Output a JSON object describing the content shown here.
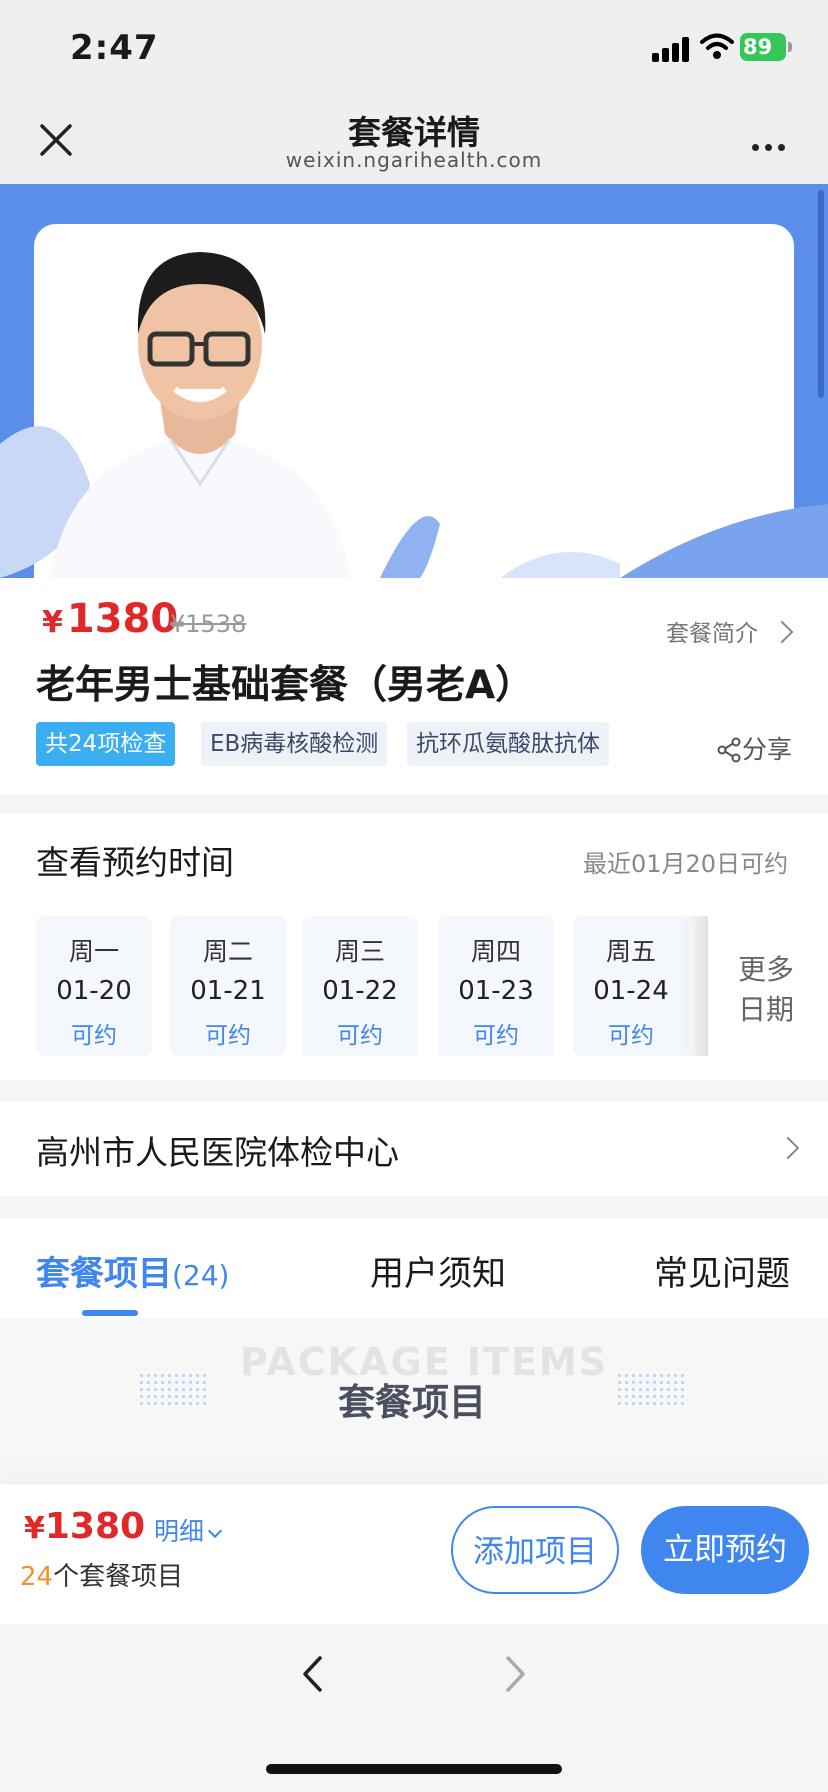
{
  "status": {
    "time": "2:47",
    "battery": "89"
  },
  "nav": {
    "title": "套餐详情",
    "subtitle": "weixin.ngarihealth.com"
  },
  "package": {
    "price_symbol": "¥",
    "price": "1380",
    "old_price": "¥1538",
    "intro_link": "套餐简介",
    "name": "老年男士基础套餐（男老A）",
    "tags": [
      "共24项检查",
      "EB病毒核酸检测",
      "抗环瓜氨酸肽抗体"
    ],
    "share": "分享"
  },
  "appointment": {
    "title": "查看预约时间",
    "recent": "最近01月20日可约",
    "days": [
      {
        "weekday": "周一",
        "date": "01-20",
        "status": "可约"
      },
      {
        "weekday": "周二",
        "date": "01-21",
        "status": "可约"
      },
      {
        "weekday": "周三",
        "date": "01-22",
        "status": "可约"
      },
      {
        "weekday": "周四",
        "date": "01-23",
        "status": "可约"
      },
      {
        "weekday": "周五",
        "date": "01-24",
        "status": "可约"
      }
    ],
    "more_line1": "更多",
    "more_line2": "日期"
  },
  "hospital": {
    "name": "高州市人民医院体检中心"
  },
  "tabs": {
    "items": "套餐项目",
    "items_count": "(24)",
    "notice": "用户须知",
    "faq": "常见问题"
  },
  "banner": {
    "watermark": "PACKAGE ITEMS",
    "title": "套餐项目"
  },
  "bottom": {
    "price_symbol": "¥",
    "price": "1380",
    "detail": "明细",
    "count": "24",
    "count_suffix": "个套餐项目",
    "add_button": "添加项目",
    "book_button": "立即预约"
  },
  "colors": {
    "accent": "#3f86ee",
    "price": "#e02828",
    "hero": "#5a8ee8"
  }
}
